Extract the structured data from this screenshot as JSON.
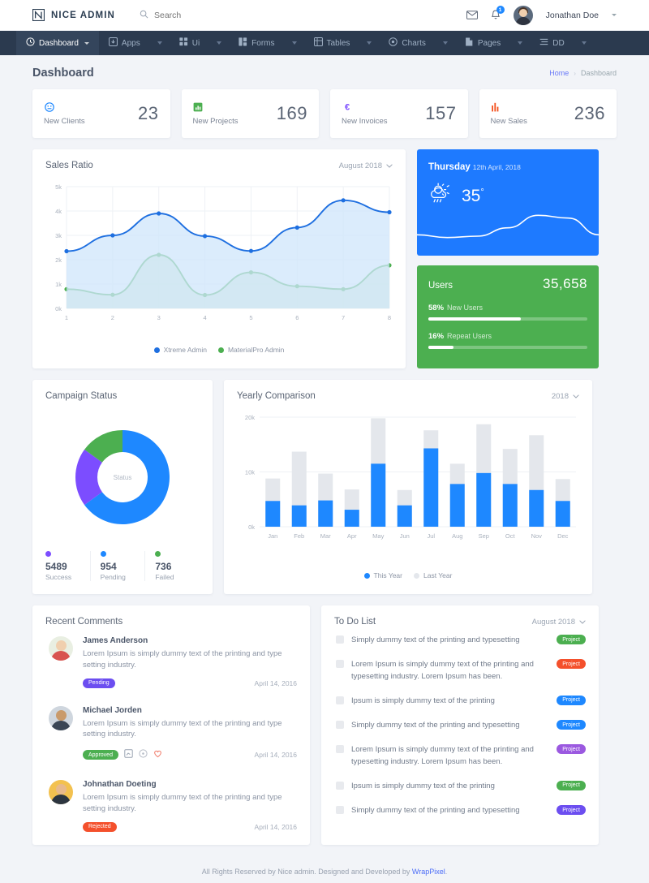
{
  "brand": {
    "name": "NICE ADMIN",
    "logo_icon": "nice-admin-logo"
  },
  "search": {
    "placeholder": "Search",
    "icon": "search-icon"
  },
  "topbar": {
    "mail_icon": "mail-icon",
    "bell_icon": "bell-icon",
    "notification_count": "1",
    "username": "Jonathan Doe",
    "avatar_icon": "user-avatar"
  },
  "nav": {
    "items": [
      {
        "label": "Dashboard",
        "icon": "clock-icon",
        "active": true,
        "caret": true
      },
      {
        "label": "Apps",
        "icon": "apps-icon",
        "active": false,
        "caret": true
      },
      {
        "label": "Ui",
        "icon": "grid-icon",
        "active": false,
        "caret": true
      },
      {
        "label": "Forms",
        "icon": "forms-icon",
        "active": false,
        "caret": true
      },
      {
        "label": "Tables",
        "icon": "table-icon",
        "active": false,
        "caret": true
      },
      {
        "label": "Charts",
        "icon": "pie-chart-icon",
        "active": false,
        "caret": true
      },
      {
        "label": "Pages",
        "icon": "page-icon",
        "active": false,
        "caret": true
      },
      {
        "label": "DD",
        "icon": "menu-lines-icon",
        "active": false,
        "caret": true
      }
    ]
  },
  "page": {
    "title": "Dashboard",
    "breadcrumb": {
      "home": "Home",
      "separator": "›",
      "current": "Dashboard"
    }
  },
  "stats": [
    {
      "label": "New Clients",
      "value": "23",
      "icon": "smiley-icon",
      "color": "#1e88ff"
    },
    {
      "label": "New Projects",
      "value": "169",
      "icon": "chart-square-icon",
      "color": "#4caf50"
    },
    {
      "label": "New Invoices",
      "value": "157",
      "icon": "euro-icon",
      "color": "#7c4dff"
    },
    {
      "label": "New Sales",
      "value": "236",
      "icon": "bar-chart-icon",
      "color": "#f4511e"
    }
  ],
  "sales_ratio": {
    "title": "Sales Ratio",
    "select_value": "August 2018",
    "select_icon": "chevron-down-icon"
  },
  "weather": {
    "day": "Thursday",
    "date": "12th April, 2018",
    "temperature": "35",
    "degree_symbol": "°",
    "icon": "sun-cloud-rain-icon",
    "bg_color": "#1e7aff"
  },
  "users": {
    "label": "Users",
    "count": "35,658",
    "bg_color": "#4caf50",
    "progress": [
      {
        "percent": "58%",
        "label": "New Users",
        "value": 58
      },
      {
        "percent": "16%",
        "label": "Repeat Users",
        "value": 16
      }
    ]
  },
  "campaign": {
    "title": "Campaign Status",
    "center_label": "Status",
    "stats": [
      {
        "value": "5489",
        "label": "Success",
        "color": "#7c4dff"
      },
      {
        "value": "954",
        "label": "Pending",
        "color": "#1e88ff"
      },
      {
        "value": "736",
        "label": "Failed",
        "color": "#4caf50"
      }
    ]
  },
  "yearly": {
    "title": "Yearly Comparison",
    "select_value": "2018",
    "select_icon": "chevron-down-icon"
  },
  "comments": {
    "title": "Recent Comments",
    "items": [
      {
        "name": "James Anderson",
        "text": "Lorem Ipsum is simply dummy text of the printing and type setting industry.",
        "status": "Pending",
        "status_color": "#6c4ef0",
        "date": "April 14, 2016",
        "actions": [],
        "avatar_skin": "#f0cfae",
        "avatar_hair": "#2b2118",
        "avatar_body": "#d8534f",
        "avatar_bg": "#e9efe2"
      },
      {
        "name": "Michael Jorden",
        "text": "Lorem Ipsum is simply dummy text of the printing and type setting industry.",
        "status": "Approved",
        "status_color": "#4caf50",
        "date": "April 14, 2016",
        "actions": [
          "chart-icon",
          "clock-icon",
          "heart-icon"
        ],
        "avatar_skin": "#c99a6b",
        "avatar_hair": "#1c2430",
        "avatar_body": "#3b4655",
        "avatar_bg": "#cfd6de"
      },
      {
        "name": "Johnathan Doeting",
        "text": "Lorem Ipsum is simply dummy text of the printing and type setting industry.",
        "status": "Rejected",
        "status_color": "#f4502c",
        "date": "April 14, 2016",
        "actions": [],
        "avatar_skin": "#e8b98c",
        "avatar_hair": "#20242c",
        "avatar_body": "#2c3540",
        "avatar_bg": "#f3c14f"
      }
    ]
  },
  "todo": {
    "title": "To Do List",
    "select_value": "August 2018",
    "select_icon": "chevron-down-icon",
    "items": [
      {
        "text": "Simply dummy text of the printing and typesetting",
        "badge": "Project",
        "badge_color": "#4caf50"
      },
      {
        "text": "Lorem Ipsum is simply dummy text of the printing and typesetting industry. Lorem Ipsum has been.",
        "badge": "Project",
        "badge_color": "#f4502c"
      },
      {
        "text": "Ipsum is simply dummy text of the printing",
        "badge": "Project",
        "badge_color": "#1e88ff"
      },
      {
        "text": "Simply dummy text of the printing and typesetting",
        "badge": "Project",
        "badge_color": "#1e88ff"
      },
      {
        "text": "Lorem Ipsum is simply dummy text of the printing and typesetting industry. Lorem Ipsum has been.",
        "badge": "Project",
        "badge_color": "#9b59e0"
      },
      {
        "text": "Ipsum is simply dummy text of the printing",
        "badge": "Project",
        "badge_color": "#4caf50"
      },
      {
        "text": "Simply dummy text of the printing and typesetting",
        "badge": "Project",
        "badge_color": "#6c4ef0"
      }
    ]
  },
  "footer": {
    "text": "All Rights Reserved by Nice admin. Designed and Developed by ",
    "link": "WrapPixel",
    "suffix": "."
  },
  "chart_data": [
    {
      "type": "line",
      "title": "Sales Ratio",
      "x": [
        1,
        2,
        3,
        4,
        5,
        6,
        7,
        8
      ],
      "xlabel": "",
      "ylabel": "",
      "ylim": [
        0,
        5000
      ],
      "ytick_labels": [
        "0k",
        "1k",
        "2k",
        "3k",
        "4k",
        "5k"
      ],
      "ytick_values": [
        0,
        1000,
        2000,
        3000,
        4000,
        5000
      ],
      "grid": true,
      "legend_position": "bottom",
      "series": [
        {
          "name": "Xtreme Admin",
          "color": "#1e6fe0",
          "fill": "#cfe6fb",
          "values": [
            2350,
            3000,
            3900,
            2970,
            2360,
            3320,
            4440,
            3950
          ]
        },
        {
          "name": "MaterialPro Admin",
          "color": "#4caf50",
          "fill": "#d8edd2",
          "values": [
            790,
            560,
            2200,
            550,
            1480,
            910,
            790,
            1770
          ]
        }
      ]
    },
    {
      "type": "pie",
      "title": "Campaign Status",
      "center_label": "Status",
      "donut": true,
      "labels": [
        "Success",
        "Pending",
        "Failed"
      ],
      "values": [
        5489,
        954,
        736
      ],
      "display_values": [
        65,
        20,
        15
      ],
      "colors": [
        "#1e88ff",
        "#7c4dff",
        "#4caf50"
      ],
      "legend_position": "bottom"
    },
    {
      "type": "bar",
      "title": "Yearly Comparison",
      "categories": [
        "Jan",
        "Feb",
        "Mar",
        "Apr",
        "May",
        "Jun",
        "Jul",
        "Aug",
        "Sep",
        "Oct",
        "Nov",
        "Dec"
      ],
      "xlabel": "",
      "ylabel": "",
      "ylim": [
        0,
        20000
      ],
      "ytick_labels": [
        "0k",
        "10k",
        "20k"
      ],
      "ytick_values": [
        0,
        10000,
        20000
      ],
      "grid": true,
      "legend_position": "bottom",
      "stacked": true,
      "series": [
        {
          "name": "This Year",
          "color": "#1e88ff",
          "values": [
            4700,
            3900,
            4800,
            3100,
            11500,
            3900,
            14300,
            7800,
            9800,
            7800,
            6700,
            4700
          ]
        },
        {
          "name": "Last Year",
          "color": "#e4e7ec",
          "values": [
            8800,
            13700,
            9700,
            6800,
            19800,
            6700,
            17600,
            11500,
            18700,
            14200,
            16700,
            8700
          ]
        }
      ]
    },
    {
      "type": "line",
      "title": "Weather trend",
      "x": [
        0,
        1,
        2,
        3,
        4,
        5,
        6
      ],
      "values": [
        30,
        26,
        28,
        40,
        58,
        54,
        30
      ],
      "color": "#ffffff",
      "grid": false
    }
  ]
}
